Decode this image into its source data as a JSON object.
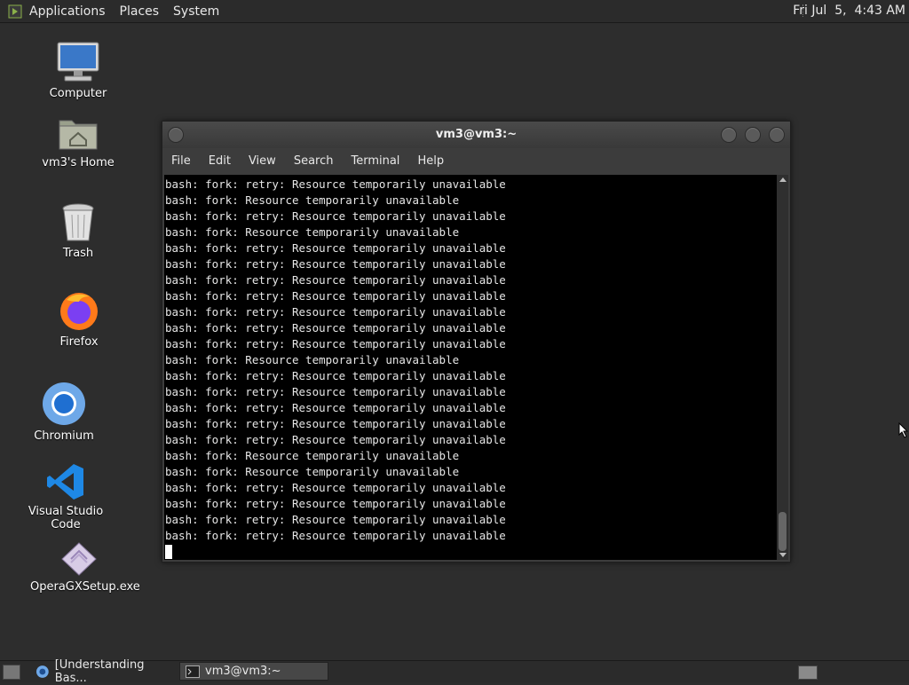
{
  "top_panel": {
    "menus": [
      "Applications",
      "Places",
      "System"
    ],
    "clock": "Fri Jul  5,  4:43 AM"
  },
  "desktop_icons": [
    {
      "label": "Computer",
      "icon": "computer-icon"
    },
    {
      "label": "vm3's Home",
      "icon": "home-folder-icon"
    },
    {
      "label": "Trash",
      "icon": "trash-icon"
    },
    {
      "label": "Firefox",
      "icon": "firefox-icon"
    },
    {
      "label": "Chromium",
      "icon": "chromium-icon"
    },
    {
      "label": "Visual Studio Code",
      "icon": "vscode-icon"
    },
    {
      "label": "OperaGXSetup.exe",
      "icon": "installer-icon"
    }
  ],
  "terminal": {
    "title": "vm3@vm3:~",
    "menu": [
      "File",
      "Edit",
      "View",
      "Search",
      "Terminal",
      "Help"
    ],
    "lines": [
      "bash: fork: retry: Resource temporarily unavailable",
      "bash: fork: Resource temporarily unavailable",
      "bash: fork: retry: Resource temporarily unavailable",
      "bash: fork: Resource temporarily unavailable",
      "bash: fork: retry: Resource temporarily unavailable",
      "bash: fork: retry: Resource temporarily unavailable",
      "bash: fork: retry: Resource temporarily unavailable",
      "bash: fork: retry: Resource temporarily unavailable",
      "bash: fork: retry: Resource temporarily unavailable",
      "bash: fork: retry: Resource temporarily unavailable",
      "bash: fork: retry: Resource temporarily unavailable",
      "bash: fork: Resource temporarily unavailable",
      "bash: fork: retry: Resource temporarily unavailable",
      "bash: fork: retry: Resource temporarily unavailable",
      "bash: fork: retry: Resource temporarily unavailable",
      "bash: fork: retry: Resource temporarily unavailable",
      "bash: fork: retry: Resource temporarily unavailable",
      "bash: fork: Resource temporarily unavailable",
      "bash: fork: Resource temporarily unavailable",
      "bash: fork: retry: Resource temporarily unavailable",
      "bash: fork: retry: Resource temporarily unavailable",
      "bash: fork: retry: Resource temporarily unavailable",
      "bash: fork: retry: Resource temporarily unavailable"
    ]
  },
  "taskbar": {
    "tasks": [
      {
        "label": "[Understanding Bas...",
        "icon": "browser-icon"
      },
      {
        "label": "vm3@vm3:~",
        "icon": "terminal-icon"
      }
    ]
  },
  "colors": {
    "desktop_bg": "#2d2d2d",
    "panel_bg": "#2b2b2b",
    "terminal_bg": "#000000",
    "terminal_fg": "#e6e6e6"
  }
}
